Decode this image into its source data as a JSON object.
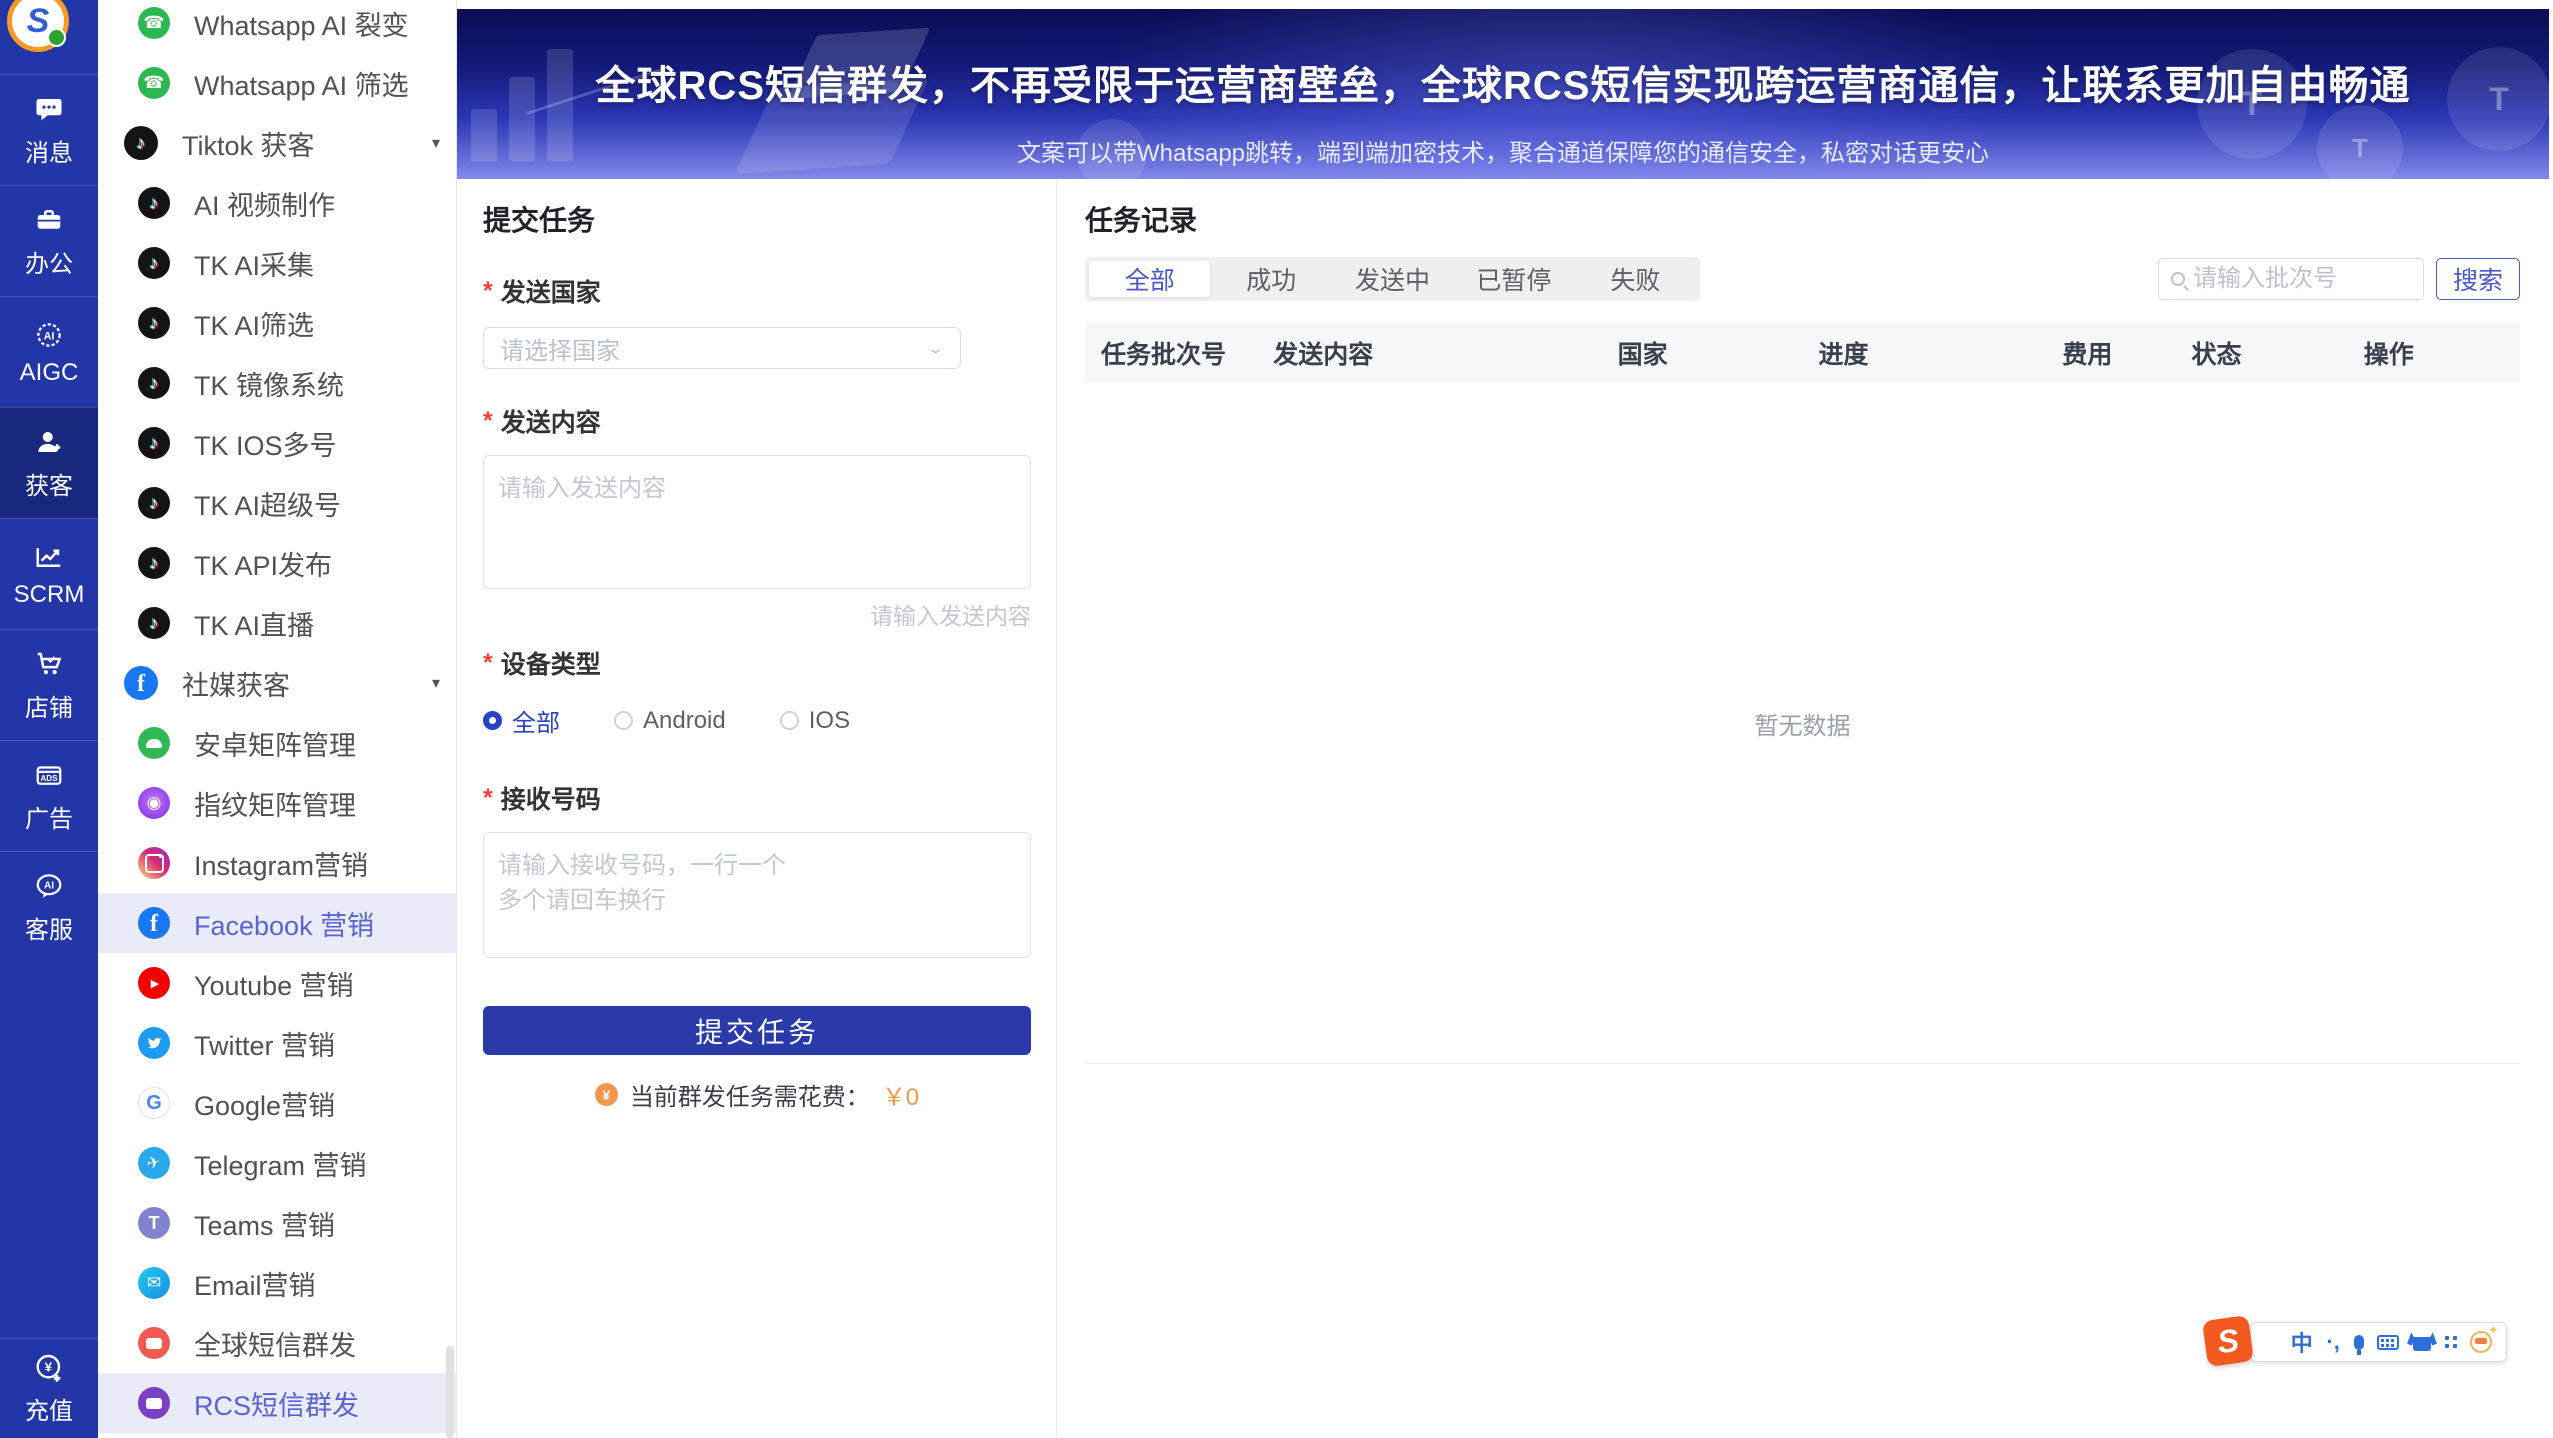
{
  "colors": {
    "rail_bg": "#2236a8",
    "rail_active_bg": "#19287f",
    "accent_indigo": "#2742c8",
    "submit_bg": "#2a3aa8",
    "selected_item_bg": "#e9ebf8",
    "selected_item_text": "#5a63cf",
    "fee_orange": "#f2994a",
    "required_red": "#f04134",
    "banner_gradient_top": "#0a0d52",
    "banner_gradient_bottom": "#8289ea"
  },
  "rail": {
    "logo_letter": "S",
    "items": [
      {
        "icon": "message-icon",
        "label": "消息"
      },
      {
        "icon": "briefcase-icon",
        "label": "办公"
      },
      {
        "icon": "aigc-badge-icon",
        "label": "AIGC"
      },
      {
        "icon": "person-add-icon",
        "label": "获客",
        "active": true
      },
      {
        "icon": "trend-chart-icon",
        "label": "SCRM"
      },
      {
        "icon": "cart-icon",
        "label": "店铺"
      },
      {
        "icon": "ads-icon",
        "label": "广告"
      },
      {
        "icon": "service-bubble-icon",
        "label": "客服"
      }
    ],
    "bottom_item": {
      "icon": "recharge-yen-icon",
      "label": "充值"
    }
  },
  "sidebar": {
    "items": [
      {
        "icon": "whatsapp-icon",
        "label": "Whatsapp AI 裂变",
        "level": "sub"
      },
      {
        "icon": "whatsapp-icon",
        "label": "Whatsapp AI 筛选",
        "level": "sub"
      },
      {
        "icon": "tiktok-icon",
        "label": "Tiktok 获客",
        "level": "top",
        "caret": "▾"
      },
      {
        "icon": "tiktok-icon",
        "label": "AI 视频制作",
        "level": "sub"
      },
      {
        "icon": "tiktok-icon",
        "label": "TK AI采集",
        "level": "sub"
      },
      {
        "icon": "tiktok-icon",
        "label": "TK AI筛选",
        "level": "sub"
      },
      {
        "icon": "tiktok-icon",
        "label": "TK 镜像系统",
        "level": "sub"
      },
      {
        "icon": "tiktok-icon",
        "label": "TK IOS多号",
        "level": "sub"
      },
      {
        "icon": "tiktok-icon",
        "label": "TK AI超级号",
        "level": "sub"
      },
      {
        "icon": "tiktok-icon",
        "label": "TK API发布",
        "level": "sub"
      },
      {
        "icon": "tiktok-icon",
        "label": "TK AI直播",
        "level": "sub"
      },
      {
        "icon": "facebook-icon",
        "label": "社媒获客",
        "level": "top",
        "caret": "▾"
      },
      {
        "icon": "android-icon",
        "label": "安卓矩阵管理",
        "level": "sub"
      },
      {
        "icon": "fingerprint-icon",
        "label": "指纹矩阵管理",
        "level": "sub"
      },
      {
        "icon": "instagram-icon",
        "label": "Instagram营销",
        "level": "sub"
      },
      {
        "icon": "facebook-icon",
        "label": "Facebook 营销",
        "level": "sub",
        "selected": true
      },
      {
        "icon": "youtube-icon",
        "label": "Youtube 营销",
        "level": "sub"
      },
      {
        "icon": "twitter-icon",
        "label": "Twitter 营销",
        "level": "sub"
      },
      {
        "icon": "google-icon",
        "label": "Google营销",
        "level": "sub"
      },
      {
        "icon": "telegram-icon",
        "label": "Telegram 营销",
        "level": "sub"
      },
      {
        "icon": "teams-icon",
        "label": "Teams 营销",
        "level": "sub"
      },
      {
        "icon": "email-icon",
        "label": "Email营销",
        "level": "sub"
      },
      {
        "icon": "global-sms-icon",
        "label": "全球短信群发",
        "level": "sub"
      },
      {
        "icon": "rcs-sms-icon",
        "label": "RCS短信群发",
        "level": "sub",
        "selected": true
      }
    ]
  },
  "banner": {
    "title": "全球RCS短信群发，不再受限于运营商壁垒，全球RCS短信实现跨运营商通信，让联系更加自由畅通",
    "subtitle": "文案可以带Whatsapp跳转，端到端加密技术，聚合通道保障您的通信安全，私密对话更安心"
  },
  "form": {
    "heading": "提交任务",
    "country_label": "发送国家",
    "country_placeholder": "请选择国家",
    "content_label": "发送内容",
    "content_placeholder": "请输入发送内容",
    "content_helper": "请输入发送内容",
    "device_label": "设备类型",
    "device_options": [
      "全部",
      "Android",
      "IOS"
    ],
    "device_selected": "全部",
    "numbers_label": "接收号码",
    "numbers_placeholder": "请输入接收号码，一行一个\n多个请回车换行",
    "submit_label": "提交任务",
    "fee_icon": "coin-yen-icon",
    "fee_prefix": "当前群发任务需花费：",
    "fee_value": "￥0"
  },
  "tasks": {
    "heading": "任务记录",
    "tabs": [
      "全部",
      "成功",
      "发送中",
      "已暂停",
      "失败"
    ],
    "active_tab": "全部",
    "search_placeholder": "请输入批次号",
    "search_button": "搜索",
    "columns": [
      "任务批次号",
      "发送内容",
      "国家",
      "进度",
      "费用",
      "状态",
      "操作"
    ],
    "empty_text": "暂无数据"
  },
  "ime": {
    "logo_letter": "S",
    "mode_label": "中",
    "punctuation_label": "·,",
    "icons": [
      "chinese-mode",
      "punctuation",
      "microphone-icon",
      "keyboard-icon",
      "skin-icon",
      "toolbox-grid-icon",
      "emoji-icon"
    ]
  }
}
